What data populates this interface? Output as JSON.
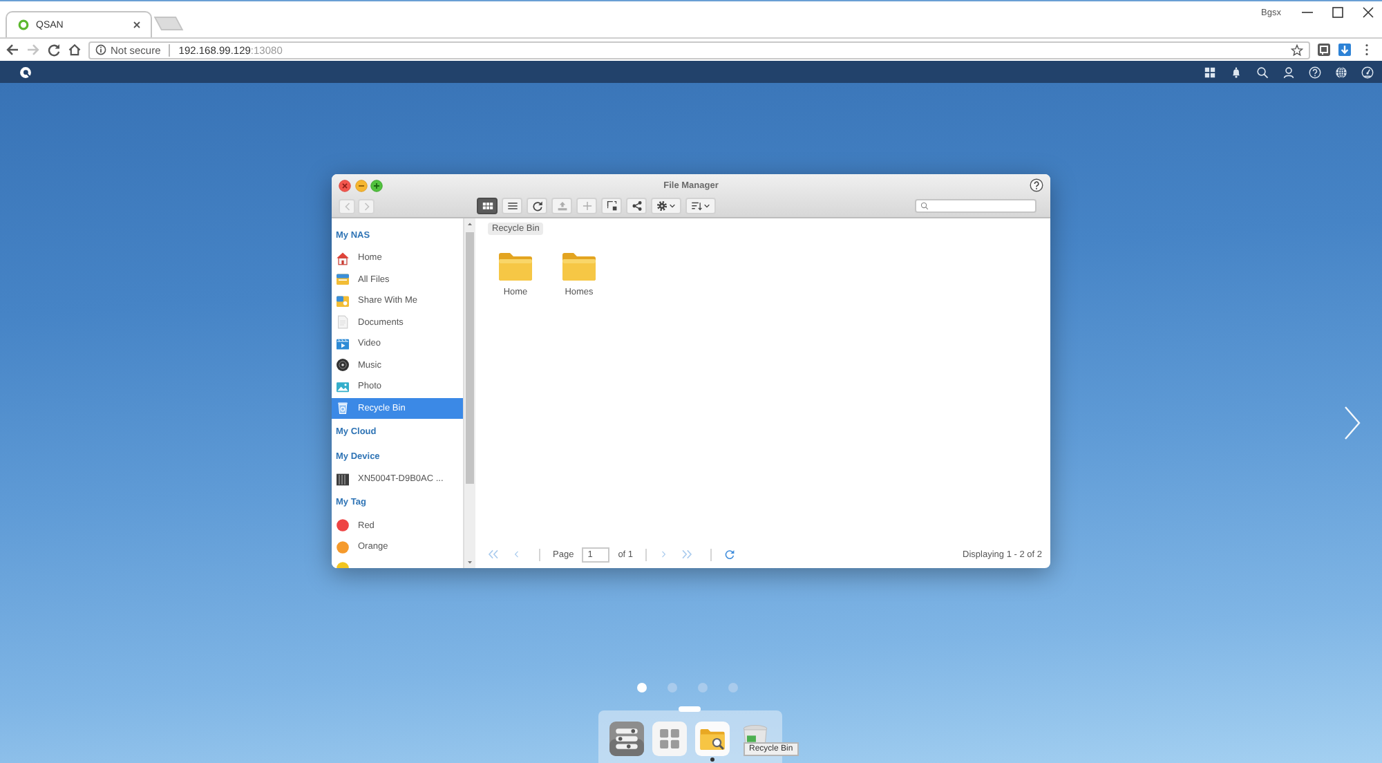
{
  "browser": {
    "tabs": [
      {
        "title": "QSAN",
        "selected": true
      }
    ],
    "profile": "Bgsx",
    "nav": [
      {
        "kind": "back",
        "disabled": false
      },
      {
        "kind": "forward",
        "disabled": true
      },
      {
        "kind": "reload",
        "disabled": false
      },
      {
        "kind": "home",
        "disabled": false
      }
    ],
    "address": {
      "security": "Not secure",
      "host": "192.168.99.129",
      "port": ":13080"
    }
  },
  "file_manager": {
    "title": "File Manager",
    "nav": [
      {
        "kind": "back",
        "disabled": true
      },
      {
        "kind": "forward",
        "disabled": true
      }
    ],
    "tools": [
      {
        "kind": "grid-view",
        "selected": true,
        "disabled": false,
        "menu": false
      },
      {
        "kind": "list-view",
        "selected": false,
        "disabled": false,
        "menu": false
      },
      {
        "kind": "refresh",
        "selected": false,
        "disabled": false,
        "menu": false
      },
      {
        "kind": "upload",
        "selected": false,
        "disabled": true,
        "menu": false
      },
      {
        "kind": "add",
        "selected": false,
        "disabled": true,
        "menu": false
      },
      {
        "kind": "copy",
        "selected": false,
        "disabled": false,
        "menu": false
      },
      {
        "kind": "share",
        "selected": false,
        "disabled": false,
        "menu": false
      },
      {
        "kind": "settings",
        "selected": false,
        "disabled": false,
        "menu": true
      },
      {
        "kind": "sort",
        "selected": false,
        "disabled": false,
        "menu": true
      }
    ],
    "sidebar": {
      "sections": [
        {
          "title": "My NAS",
          "items": [
            {
              "label": "Home",
              "kind": "home",
              "selected": false
            },
            {
              "label": "All Files",
              "kind": "all-files",
              "selected": false
            },
            {
              "label": "Share With Me",
              "kind": "shared",
              "selected": false
            },
            {
              "label": "Documents",
              "kind": "documents",
              "selected": false
            },
            {
              "label": "Video",
              "kind": "video",
              "selected": false
            },
            {
              "label": "Music",
              "kind": "music",
              "selected": false
            },
            {
              "label": "Photo",
              "kind": "photo",
              "selected": false
            },
            {
              "label": "Recycle Bin",
              "kind": "recycle-bin",
              "selected": true
            }
          ]
        },
        {
          "title": "My Cloud"
        },
        {
          "title": "My Device",
          "items": [
            {
              "label": "XN5004T-D9B0AC ...",
              "kind": "device",
              "selected": false
            }
          ]
        },
        {
          "title": "My Tag",
          "items": [
            {
              "label": "Red",
              "kind": "tag",
              "color": "#ee4444",
              "selected": false
            },
            {
              "label": "Orange",
              "kind": "tag",
              "color": "#f59a2c",
              "selected": false
            },
            {
              "kind": "tag",
              "color": "#f2c51f",
              "selected": false
            }
          ]
        }
      ]
    },
    "breadcrumb": [
      "Recycle Bin"
    ],
    "folders": [
      {
        "name": "Home"
      },
      {
        "name": "Homes"
      }
    ],
    "pager": {
      "back": [
        {
          "kind": "first",
          "disabled": true
        },
        {
          "kind": "previous",
          "disabled": true
        }
      ],
      "page_label": "Page",
      "page": "1",
      "total": "of 1",
      "forward": [
        {
          "kind": "next",
          "disabled": true
        },
        {
          "kind": "last",
          "disabled": true
        }
      ],
      "summary": "Displaying 1 - 2 of 2"
    }
  },
  "desktop": {
    "pages": [
      {
        "selected": true
      },
      {
        "selected": false
      },
      {
        "selected": false
      },
      {
        "selected": false
      }
    ],
    "dock": [
      {
        "kind": "control-panel",
        "running": false
      },
      {
        "kind": "apps",
        "running": false
      },
      {
        "kind": "file-manager",
        "running": true
      },
      {
        "kind": "recycle-bin",
        "running": false,
        "tooltip": "Recycle Bin"
      }
    ]
  }
}
